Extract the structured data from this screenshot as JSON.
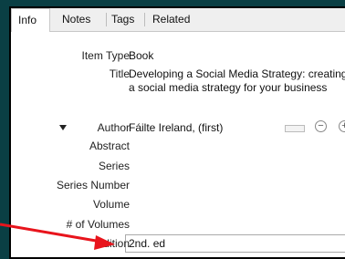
{
  "tabs": [
    {
      "label": "Info"
    },
    {
      "label": "Notes"
    },
    {
      "label": "Tags"
    },
    {
      "label": "Related"
    }
  ],
  "fields": {
    "item_type": {
      "label": "Item Type",
      "value": "Book"
    },
    "title": {
      "label": "Title",
      "value": "Developing a Social Media Strategy: creating a social media strategy for your business"
    },
    "author": {
      "label": "Author",
      "value": "Fáilte Ireland, (first)",
      "remove_symbol": "−",
      "add_symbol": "+"
    },
    "abstract": {
      "label": "Abstract",
      "value": ""
    },
    "series": {
      "label": "Series",
      "value": ""
    },
    "series_number": {
      "label": "Series Number",
      "value": ""
    },
    "volume": {
      "label": "Volume",
      "value": ""
    },
    "num_volumes": {
      "label": "# of Volumes",
      "value": ""
    },
    "edition": {
      "label": "Edition",
      "value": "2nd. ed"
    }
  },
  "colors": {
    "background": "#0a3f44",
    "arrow": "#e8141c"
  },
  "icons": {
    "creator_expand": "triangle-down-icon",
    "remove_creator": "minus-circle-icon",
    "add_creator": "plus-circle-icon"
  }
}
